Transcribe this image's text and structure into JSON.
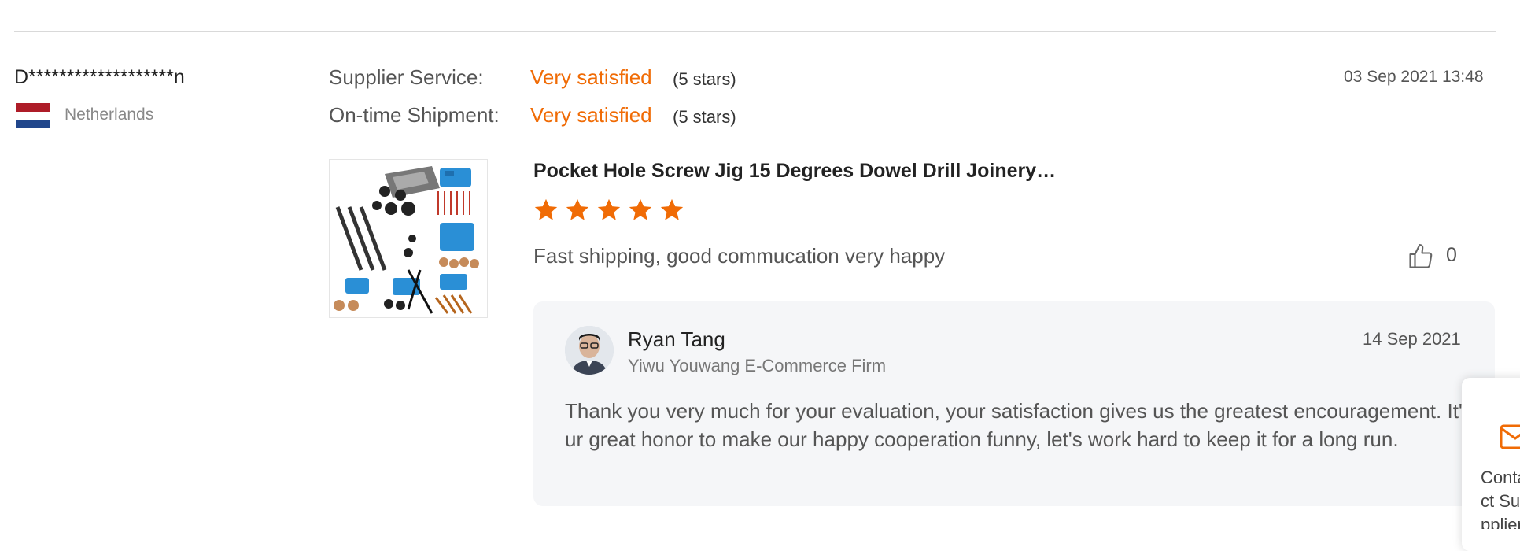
{
  "buyer": {
    "name": "D*******************n",
    "country": "Netherlands",
    "flag_colors": [
      "#ae1c28",
      "#ffffff",
      "#21468b"
    ]
  },
  "ratings": [
    {
      "label": "Supplier Service:",
      "value": "Very satisfied",
      "stars_text": "(5 stars)"
    },
    {
      "label": "On-time Shipment:",
      "value": "Very satisfied",
      "stars_text": "(5 stars)"
    }
  ],
  "review_date": "03 Sep 2021 13:48",
  "product": {
    "title": "Pocket Hole Screw Jig 15 Degrees Dowel Drill Joinery…",
    "rating": 5,
    "image_icon": "product-thumbnail"
  },
  "review": {
    "text": "Fast shipping, good commucation very happy",
    "likes": "0"
  },
  "reply": {
    "name": "Ryan Tang",
    "company": "Yiwu Youwang E-Commerce Firm",
    "date": "14 Sep 2021",
    "text": "Thank you very much for your evaluation, your satisfaction gives us the greatest encouragement. It's our great honor to make our happy cooperation funny, let's work hard to keep it for a long run."
  },
  "contact_panel": {
    "label": "Contact Supplier",
    "icon": "mail-icon"
  },
  "colors": {
    "accent": "#f06b05",
    "reply_bg": "#f5f6f8"
  }
}
